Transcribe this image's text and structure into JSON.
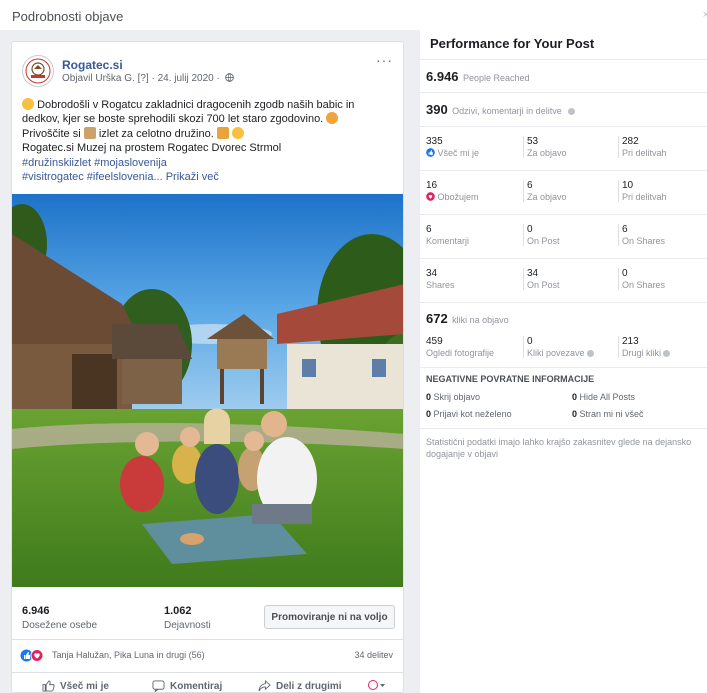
{
  "dialog": {
    "title": "Podrobnosti objave",
    "close_glyph": "×"
  },
  "post": {
    "page_name": "Rogatec.si",
    "meta": "Objavil Urška G. [?] · 24. julij 2020 ·",
    "more_glyph": "···",
    "text_lines": [
      "Dobrodošli v Rogatcu zakladnici dragocenih zgodb naših babic in",
      "dedkov, kjer se boste sprehodili skozi 700 let staro zgodovino.",
      "Privoščite si",
      "izlet za celotno družino.",
      "Rogatec.si Muzej na prostem Rogatec Dvorec Strmol"
    ],
    "hashtags_line1": "#družinskiizlet #mojaslovenija",
    "hashtags_line2": "#visitrogatec #ifeelslovenia...",
    "show_more": "Prikaži več",
    "stats": {
      "reach_value": "6.946",
      "reach_label": "Dosežene osebe",
      "engagement_value": "1.062",
      "engagement_label": "Dejavnosti"
    },
    "promote_button": "Promoviranje ni na voljo",
    "reactions_text": "Tanja Halužan, Pika Luna in drugi (56)",
    "shares_text": "34 delitev",
    "actions": {
      "like": "Všeč mi je",
      "comment": "Komentiraj",
      "share": "Deli z drugimi"
    }
  },
  "panel": {
    "title": "Performance for Your Post",
    "people_reached_value": "6.946",
    "people_reached_label": "People Reached",
    "reactions_total_value": "390",
    "reactions_total_label": "Odzivi, komentarji in delitve",
    "likes": {
      "total": "335",
      "total_label": "Všeč mi je",
      "on_post": "53",
      "on_post_label": "Za objavo",
      "on_shares": "282",
      "on_shares_label": "Pri delitvah"
    },
    "loves": {
      "total": "16",
      "total_label": "Obožujem",
      "on_post": "6",
      "on_post_label": "Za objavo",
      "on_shares": "10",
      "on_shares_label": "Pri delitvah"
    },
    "comments": {
      "total": "6",
      "total_label": "Komentarji",
      "on_post": "0",
      "on_post_label": "On Post",
      "on_shares": "6",
      "on_shares_label": "On Shares"
    },
    "shares": {
      "total": "34",
      "total_label": "Shares",
      "on_post": "34",
      "on_post_label": "On Post",
      "on_shares": "0",
      "on_shares_label": "On Shares"
    },
    "clicks_value": "672",
    "clicks_label": "kliki na objavo",
    "clicks": {
      "photo": "459",
      "photo_label": "Ogledi fotografije",
      "link": "0",
      "link_label": "Kliki povezave",
      "other": "213",
      "other_label": "Drugi kliki"
    },
    "negative_title": "NEGATIVNE POVRATNE INFORMACIJE",
    "negative": {
      "hide_post_value": "0",
      "hide_post_label": "Skrij objavo",
      "hide_all_value": "0",
      "hide_all_label": "Hide All Posts",
      "spam_value": "0",
      "spam_label": "Prijavi kot neželeno",
      "unlike_value": "0",
      "unlike_label": "Stran mi ni všeč"
    },
    "footnote": "Statistični podatki imajo lahko krajšo zakasnitev glede na dejansko dogajanje v objavi"
  },
  "colors": {
    "accent_blue": "#385898",
    "like_blue": "#1877f2",
    "love_red": "#e0245e"
  }
}
